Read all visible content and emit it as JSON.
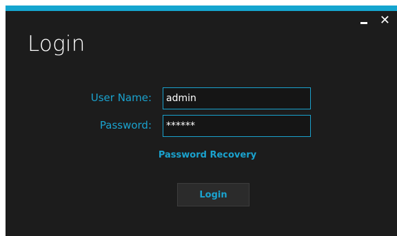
{
  "window": {
    "title": "Login",
    "controls": {
      "minimize_icon": "minimize-icon",
      "close_icon": "close-icon",
      "close_glyph": "✕"
    },
    "accent_color": "#15a5cf",
    "background_color": "#1c1c1c"
  },
  "form": {
    "username": {
      "label": "User Name:",
      "value": "admin"
    },
    "password": {
      "label": "Password:",
      "value": "******"
    },
    "recovery_link_label": "Password Recovery",
    "submit_label": "Login"
  }
}
